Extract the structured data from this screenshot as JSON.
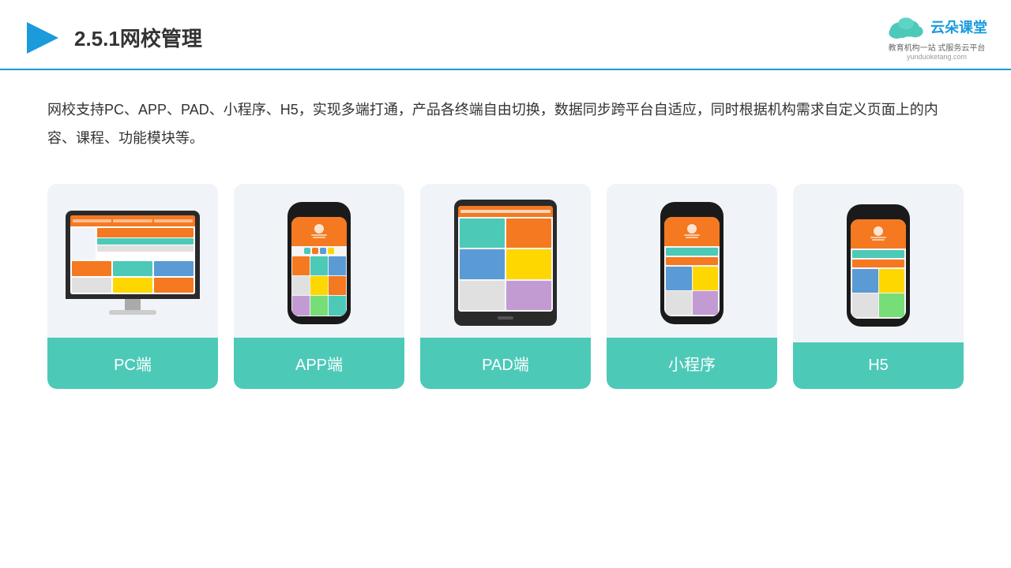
{
  "header": {
    "title": "2.5.1网校管理",
    "logo_text": "云朵课堂",
    "logo_sub1": "教育机构一站",
    "logo_sub2": "式服务云平台",
    "logo_url": "yunduoketang.com"
  },
  "description": "网校支持PC、APP、PAD、小程序、H5，实现多端打通，产品各终端自由切换，数据同步跨平台自适应，同时根据机构需求自定义页面上的内容、课程、功能模块等。",
  "cards": [
    {
      "id": "pc",
      "label": "PC端"
    },
    {
      "id": "app",
      "label": "APP端"
    },
    {
      "id": "pad",
      "label": "PAD端"
    },
    {
      "id": "miniprogram",
      "label": "小程序"
    },
    {
      "id": "h5",
      "label": "H5"
    }
  ],
  "accent_color": "#4dc9b8"
}
